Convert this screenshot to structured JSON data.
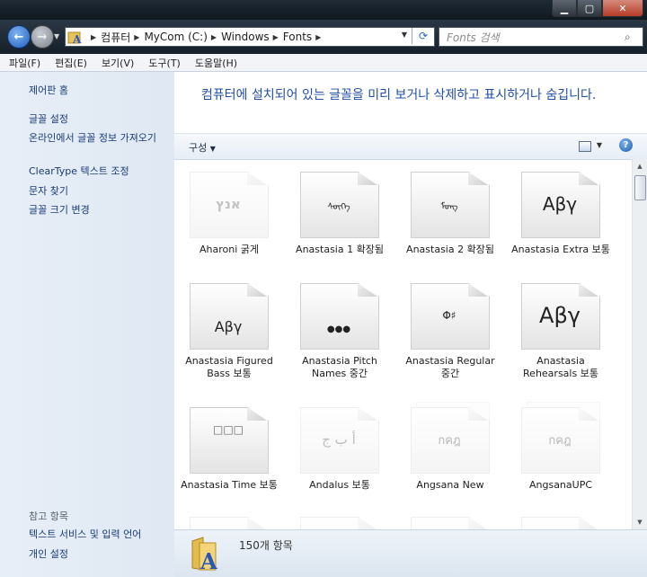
{
  "window": {
    "minimize_icon": "minimize-icon",
    "maximize_icon": "maximize-icon",
    "close_icon": "close-icon"
  },
  "address": {
    "breadcrumbs": [
      "컴퓨터",
      "MyCom (C:)",
      "Windows",
      "Fonts"
    ],
    "search_placeholder": "Fonts 검색"
  },
  "menu": [
    "파일(F)",
    "편집(E)",
    "보기(V)",
    "도구(T)",
    "도움말(H)"
  ],
  "sidebar": {
    "home": "제어판 홈",
    "links": [
      "글꼴 설정",
      "온라인에서 글꼴 정보 가져오기",
      "ClearType 텍스트 조정",
      "문자 찾기",
      "글꼴 크기 변경"
    ],
    "see_also_header": "참고 항목",
    "see_also": [
      "텍스트 서비스 및 입력 언어",
      "개인 설정"
    ]
  },
  "main": {
    "headline": "컴퓨터에 설치되어 있는 글꼴을 미리 보거나 삭제하고 표시하거나 숨깁니다.",
    "organize": "구성",
    "fonts": [
      {
        "name": "Aharoni 굵게",
        "sample": "אנץ"
      },
      {
        "name": "Anastasia 1 확장됨",
        "sample": "ᠰᠦᠭᠡ"
      },
      {
        "name": "Anastasia 2 확장됨",
        "sample": "ᠮᠣᠩ"
      },
      {
        "name": "Anastasia Extra 보통",
        "sample": "Αβγ"
      },
      {
        "name": "Anastasia Figured Bass 보통",
        "sample": "Αβγ"
      },
      {
        "name": "Anastasia Pitch Names 중간",
        "sample": "●●●"
      },
      {
        "name": "Anastasia Regular 중간",
        "sample": "Φ♯"
      },
      {
        "name": "Anastasia Rehearsals 보통",
        "sample": "Αβγ"
      },
      {
        "name": "Anastasia Time 보통",
        "sample": "□□□"
      },
      {
        "name": "Andalus 보통",
        "sample": "أ ب ج"
      },
      {
        "name": "Angsana New",
        "sample": "กคฎ"
      },
      {
        "name": "AngsanaUPC",
        "sample": "กคฎ"
      }
    ],
    "item_count": "150개 항목"
  }
}
